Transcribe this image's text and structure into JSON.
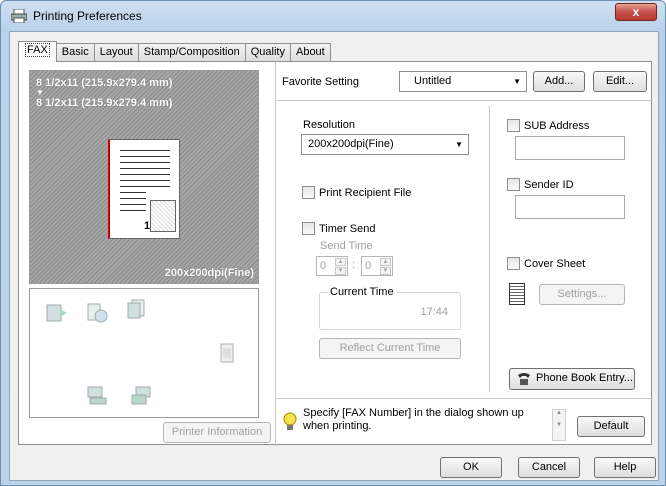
{
  "window": {
    "title": "Printing Preferences",
    "close": "x"
  },
  "tabs": [
    {
      "label": "FAX"
    },
    {
      "label": "Basic"
    },
    {
      "label": "Layout"
    },
    {
      "label": "Stamp/Composition"
    },
    {
      "label": "Quality"
    },
    {
      "label": "About"
    }
  ],
  "preview": {
    "original_size": "8 1/2x11 (215.9x279.4 mm)",
    "output_size": "8 1/2x11 (215.9x279.4 mm)",
    "resolution": "200x200dpi(Fine)",
    "page_number": "1"
  },
  "printer_info_button": "Printer Information",
  "favorite": {
    "label": "Favorite Setting",
    "value": "Untitled",
    "add": "Add...",
    "edit": "Edit..."
  },
  "resolution": {
    "label": "Resolution",
    "value": "200x200dpi(Fine)"
  },
  "print_recipient_file": {
    "label": "Print Recipient File"
  },
  "timer_send": {
    "label": "Timer Send",
    "send_time_label": "Send Time",
    "hour": "0",
    "minute": "0",
    "separator": ":"
  },
  "current_time": {
    "label": "Current Time",
    "value": "17:44",
    "reflect_button": "Reflect Current Time"
  },
  "sub_address": {
    "label": "SUB Address"
  },
  "sender_id": {
    "label": "Sender ID"
  },
  "cover_sheet": {
    "label": "Cover Sheet",
    "settings_button": "Settings..."
  },
  "phone_book_button": "Phone Book Entry...",
  "info_message": "Specify [FAX Number] in the dialog shown up when printing.",
  "default_button": "Default",
  "footer": {
    "ok": "OK",
    "cancel": "Cancel",
    "help": "Help"
  }
}
